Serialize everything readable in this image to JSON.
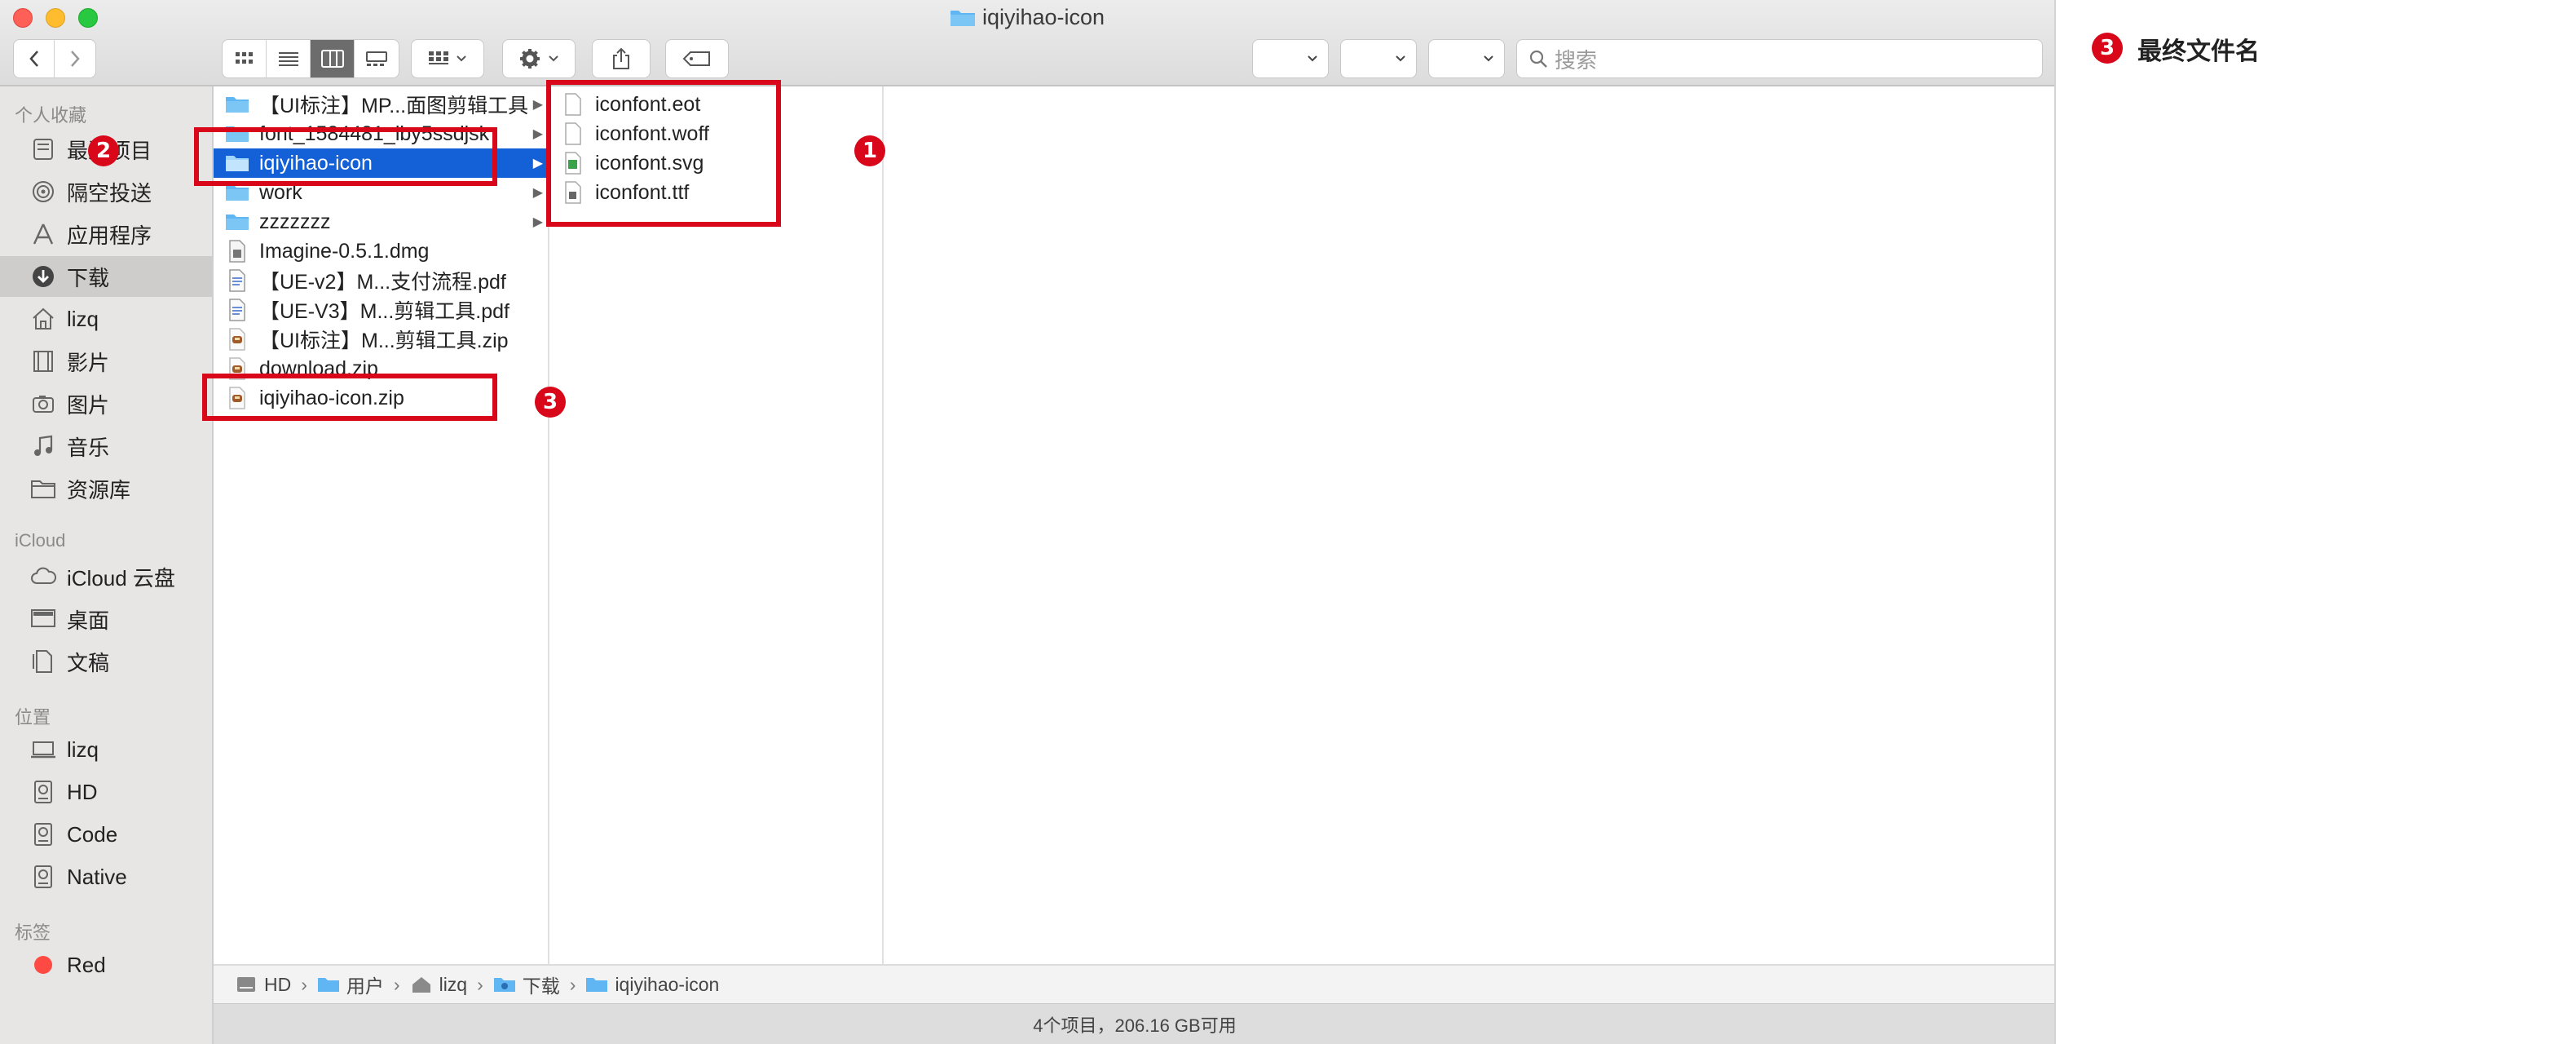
{
  "window": {
    "title": "iqiyihao-icon",
    "search_placeholder": "搜索"
  },
  "sidebar": {
    "favorites_header": "个人收藏",
    "favorites": [
      {
        "label": "最近项目",
        "icon": "clock-icon"
      },
      {
        "label": "隔空投送",
        "icon": "airdrop-icon"
      },
      {
        "label": "应用程序",
        "icon": "applications-icon"
      },
      {
        "label": "下载",
        "icon": "downloads-icon",
        "selected": true
      },
      {
        "label": "lizq",
        "icon": "home-icon"
      },
      {
        "label": "影片",
        "icon": "movies-icon"
      },
      {
        "label": "图片",
        "icon": "camera-icon"
      },
      {
        "label": "音乐",
        "icon": "music-icon"
      },
      {
        "label": "资源库",
        "icon": "folder-icon"
      }
    ],
    "icloud_header": "iCloud",
    "icloud": [
      {
        "label": "iCloud 云盘",
        "icon": "cloud-icon"
      },
      {
        "label": "桌面",
        "icon": "desktop-icon"
      },
      {
        "label": "文稿",
        "icon": "document-icon"
      }
    ],
    "locations_header": "位置",
    "locations": [
      {
        "label": "lizq",
        "icon": "laptop-icon"
      },
      {
        "label": "HD",
        "icon": "disk-icon"
      },
      {
        "label": "Code",
        "icon": "disk-icon"
      },
      {
        "label": "Native",
        "icon": "disk-icon"
      }
    ],
    "tags_header": "标签",
    "tags": [
      {
        "label": "Red",
        "color": "#ff4a43"
      }
    ]
  },
  "column1": [
    {
      "name": "【UI标注】MP...面图剪辑工具",
      "type": "folder"
    },
    {
      "name": "font_1584481_lby5ssdjsk",
      "type": "folder"
    },
    {
      "name": "iqiyihao-icon",
      "type": "folder",
      "selected": true
    },
    {
      "name": "work",
      "type": "folder"
    },
    {
      "name": "zzzzzzz",
      "type": "folder"
    },
    {
      "name": "Imagine-0.5.1.dmg",
      "type": "dmg"
    },
    {
      "name": "【UE-v2】M...支付流程.pdf",
      "type": "pdf"
    },
    {
      "name": "【UE-V3】M...剪辑工具.pdf",
      "type": "pdf"
    },
    {
      "name": "【UI标注】M...剪辑工具.zip",
      "type": "zip"
    },
    {
      "name": "download.zip",
      "type": "zip"
    },
    {
      "name": "iqiyihao-icon.zip",
      "type": "zip"
    }
  ],
  "column2": [
    {
      "name": "iconfont.eot",
      "type": "file"
    },
    {
      "name": "iconfont.woff",
      "type": "file"
    },
    {
      "name": "iconfont.svg",
      "type": "svg"
    },
    {
      "name": "iconfont.ttf",
      "type": "ttf"
    }
  ],
  "pathbar": [
    {
      "label": "HD",
      "icon": "disk-icon"
    },
    {
      "label": "用户",
      "icon": "folder-icon"
    },
    {
      "label": "lizq",
      "icon": "home-icon"
    },
    {
      "label": "下载",
      "icon": "downloads-folder-icon"
    },
    {
      "label": "iqiyihao-icon",
      "icon": "folder-icon"
    }
  ],
  "status": "4个项目，206.16 GB可用",
  "annotations": {
    "badge1": "1",
    "badge2": "2",
    "badge3": "3",
    "legend_badge": "3",
    "legend_text": "最终文件名"
  },
  "colors": {
    "selection": "#1460d6",
    "annotation": "#d8071a",
    "folder": "#5fb6f2"
  }
}
